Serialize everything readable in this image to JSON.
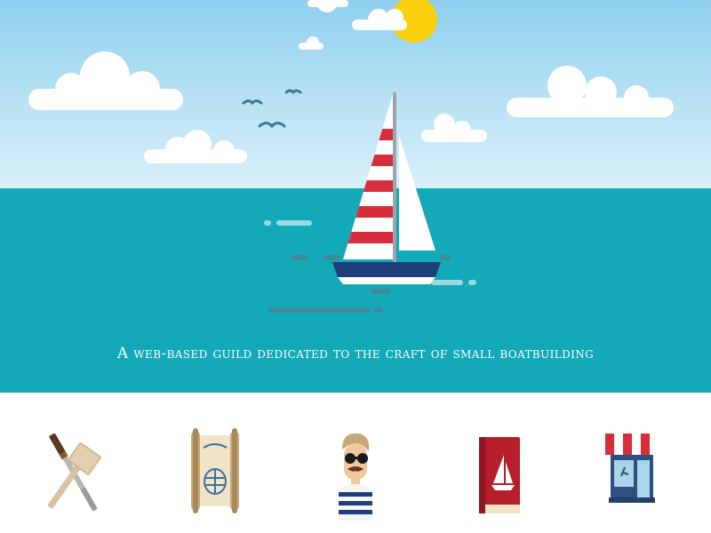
{
  "hero": {
    "tagline": "A web-based guild dedicated to the craft of small boatbuilding"
  },
  "colors": {
    "sky": "#b9e2f4",
    "sea": "#14a9b9",
    "sun": "#fbd10f",
    "stripe_red": "#d62e3a",
    "hull_navy": "#1f3f7a"
  },
  "features": [
    {
      "icon": "tools-icon"
    },
    {
      "icon": "blueprint-scroll-icon"
    },
    {
      "icon": "sailor-icon"
    },
    {
      "icon": "boat-book-icon"
    },
    {
      "icon": "shop-icon"
    }
  ]
}
